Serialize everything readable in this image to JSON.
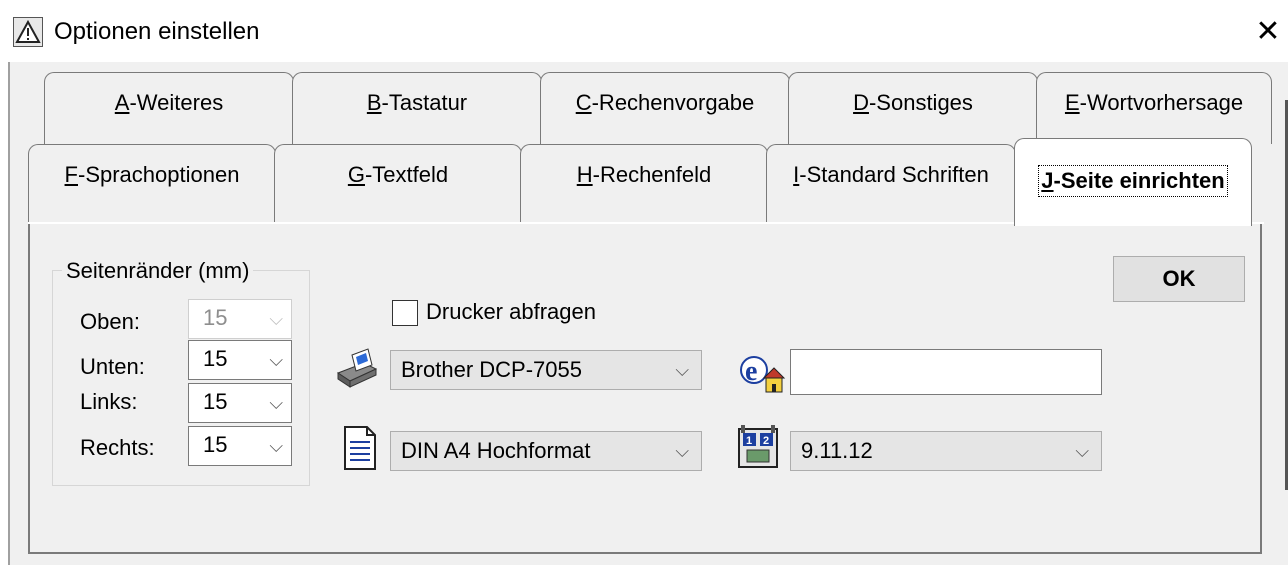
{
  "window": {
    "title": "Optionen einstellen",
    "close_glyph": "✕"
  },
  "tabs_row_back": [
    {
      "mnemonic": "A",
      "rest": "-Weiteres"
    },
    {
      "mnemonic": "B",
      "rest": "-Tastatur"
    },
    {
      "mnemonic": "C",
      "rest": "-Rechenvorgabe"
    },
    {
      "mnemonic": "D",
      "rest": "-Sonstiges"
    },
    {
      "mnemonic": "E",
      "rest": "-Wortvorhersage"
    }
  ],
  "tabs_row_front": [
    {
      "mnemonic": "F",
      "rest": "-Sprachoptionen"
    },
    {
      "mnemonic": "G",
      "rest": "-Textfeld"
    },
    {
      "mnemonic": "H",
      "rest": "-Rechenfeld"
    },
    {
      "mnemonic": "I",
      "rest": "-Standard Schriften"
    },
    {
      "mnemonic": "J",
      "rest": "-Seite einrichten",
      "active": true
    }
  ],
  "margins": {
    "legend": "Seitenränder (mm)",
    "rows": [
      {
        "label": "Oben:",
        "value": "15",
        "disabled": true
      },
      {
        "label": "Unten:",
        "value": "15",
        "disabled": false
      },
      {
        "label": "Links:",
        "value": "15",
        "disabled": false
      },
      {
        "label": "Rechts:",
        "value": "15",
        "disabled": false
      }
    ]
  },
  "printer": {
    "query_label": "Drucker  abfragen",
    "query_checked": false,
    "selected": "Brother DCP-7055",
    "icon": "printer-icon"
  },
  "paper": {
    "selected": "DIN A4 Hochformat",
    "icon": "page-document-icon"
  },
  "filename": {
    "value": "",
    "icon": "internet-explorer-home-icon"
  },
  "date_format": {
    "selected": "9.11.12",
    "icon": "calendar-date-icon"
  },
  "buttons": {
    "ok": "OK"
  },
  "glyphs": {
    "chevron": "⌵"
  }
}
